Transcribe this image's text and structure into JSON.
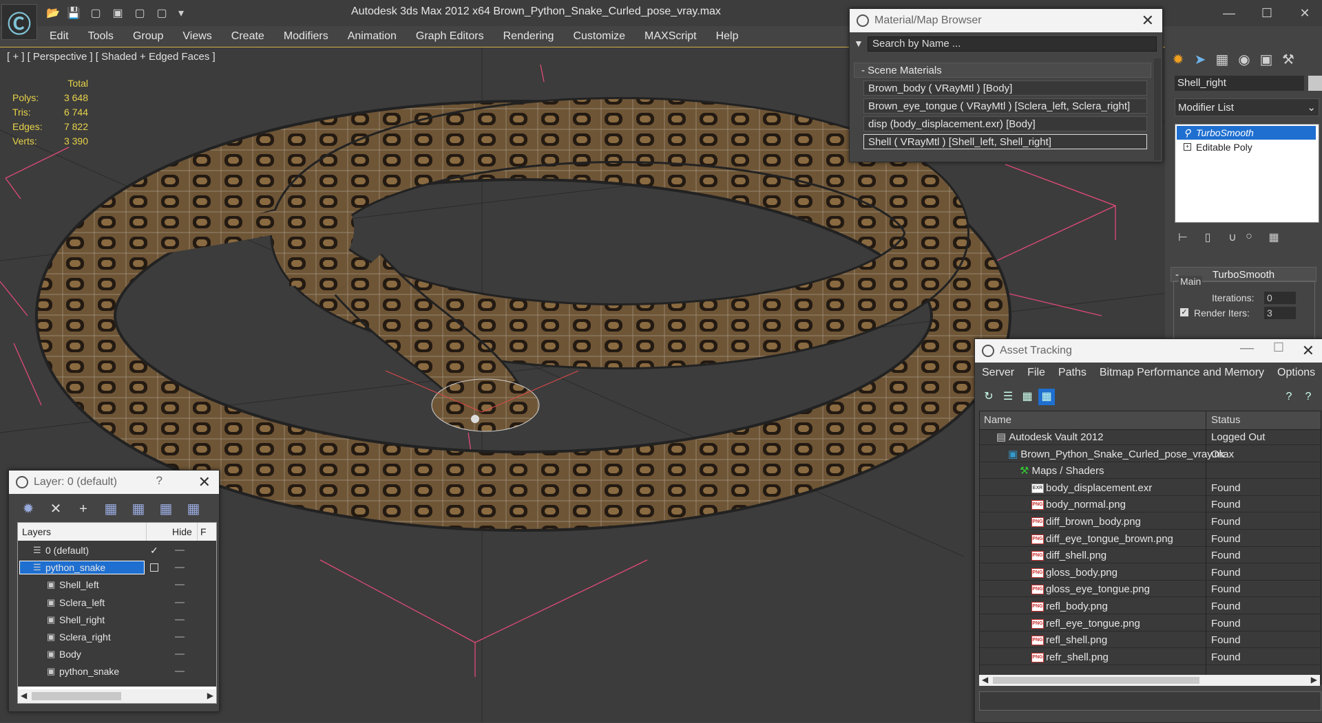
{
  "app": {
    "title": "Autodesk 3ds Max  2012 x64     Brown_Python_Snake_Curled_pose_vray.max",
    "logo": "3ds-max-logo"
  },
  "menubar": [
    "Edit",
    "Tools",
    "Group",
    "Views",
    "Create",
    "Modifiers",
    "Animation",
    "Graph Editors",
    "Rendering",
    "Customize",
    "MAXScript",
    "Help"
  ],
  "viewport": {
    "label": "[ + ] [ Perspective ] [ Shaded + Edged Faces ]",
    "stats": {
      "header": "Total",
      "rows": [
        {
          "label": "Polys:",
          "value": "3 648"
        },
        {
          "label": "Tris:",
          "value": "6 744"
        },
        {
          "label": "Edges:",
          "value": "7 822"
        },
        {
          "label": "Verts:",
          "value": "3 390"
        }
      ]
    },
    "accent": "#d6b14a",
    "stats_color": "#e8d34a"
  },
  "material_browser": {
    "title": "Material/Map Browser",
    "search_placeholder": "Search by Name ...",
    "section": "- Scene Materials",
    "items": [
      "Brown_body  ( VRayMtl ) [Body]",
      "Brown_eye_tongue  ( VRayMtl ) [Sclera_left, Sclera_right]",
      "disp (body_displacement.exr) [Body]",
      "Shell  ( VRayMtl ) [Shell_left, Shell_right]"
    ]
  },
  "command_panel": {
    "object_name": "Shell_right",
    "modifier_list": "Modifier List",
    "stack": [
      "TurboSmooth",
      "Editable Poly"
    ],
    "rollout_title": "TurboSmooth",
    "group": "Main",
    "iterations_label": "Iterations:",
    "iterations_value": "0",
    "render_iters_label": "Render Iters:",
    "render_iters_value": "3"
  },
  "asset_tracking": {
    "title": "Asset Tracking",
    "menu": [
      "Server",
      "File",
      "Paths",
      "Bitmap Performance and Memory",
      "Options"
    ],
    "columns": {
      "name": "Name",
      "status": "Status"
    },
    "rows": [
      {
        "name": "Autodesk Vault 2012",
        "status": "Logged Out",
        "indent": 0,
        "icon": "vault-icon"
      },
      {
        "name": "Brown_Python_Snake_Curled_pose_vray.max",
        "status": "Ok",
        "indent": 1,
        "icon": "max-file-icon"
      },
      {
        "name": "Maps / Shaders",
        "status": "",
        "indent": 2,
        "icon": "maps-icon"
      },
      {
        "name": "body_displacement.exr",
        "status": "Found",
        "indent": 3,
        "icon": "exr-icon"
      },
      {
        "name": "body_normal.png",
        "status": "Found",
        "indent": 3,
        "icon": "png-icon"
      },
      {
        "name": "diff_brown_body.png",
        "status": "Found",
        "indent": 3,
        "icon": "png-icon"
      },
      {
        "name": "diff_eye_tongue_brown.png",
        "status": "Found",
        "indent": 3,
        "icon": "png-icon"
      },
      {
        "name": "diff_shell.png",
        "status": "Found",
        "indent": 3,
        "icon": "png-icon"
      },
      {
        "name": "gloss_body.png",
        "status": "Found",
        "indent": 3,
        "icon": "png-icon"
      },
      {
        "name": "gloss_eye_tongue.png",
        "status": "Found",
        "indent": 3,
        "icon": "png-icon"
      },
      {
        "name": "refl_body.png",
        "status": "Found",
        "indent": 3,
        "icon": "png-icon"
      },
      {
        "name": "refl_eye_tongue.png",
        "status": "Found",
        "indent": 3,
        "icon": "png-icon"
      },
      {
        "name": "refl_shell.png",
        "status": "Found",
        "indent": 3,
        "icon": "png-icon"
      },
      {
        "name": "refr_shell.png",
        "status": "Found",
        "indent": 3,
        "icon": "png-icon"
      }
    ]
  },
  "layers": {
    "title": "Layer: 0 (default)",
    "help": "?",
    "columns": {
      "layers": "Layers",
      "hide": "Hide",
      "freeze": "F"
    },
    "rows": [
      {
        "name": "0 (default)",
        "indent": 1,
        "type": "layer"
      },
      {
        "name": "python_snake",
        "indent": 1,
        "type": "layer",
        "selected": true
      },
      {
        "name": "Shell_left",
        "indent": 2,
        "type": "object"
      },
      {
        "name": "Sclera_left",
        "indent": 2,
        "type": "object"
      },
      {
        "name": "Shell_right",
        "indent": 2,
        "type": "object"
      },
      {
        "name": "Sclera_right",
        "indent": 2,
        "type": "object"
      },
      {
        "name": "Body",
        "indent": 2,
        "type": "object"
      },
      {
        "name": "python_snake",
        "indent": 2,
        "type": "object"
      }
    ]
  }
}
